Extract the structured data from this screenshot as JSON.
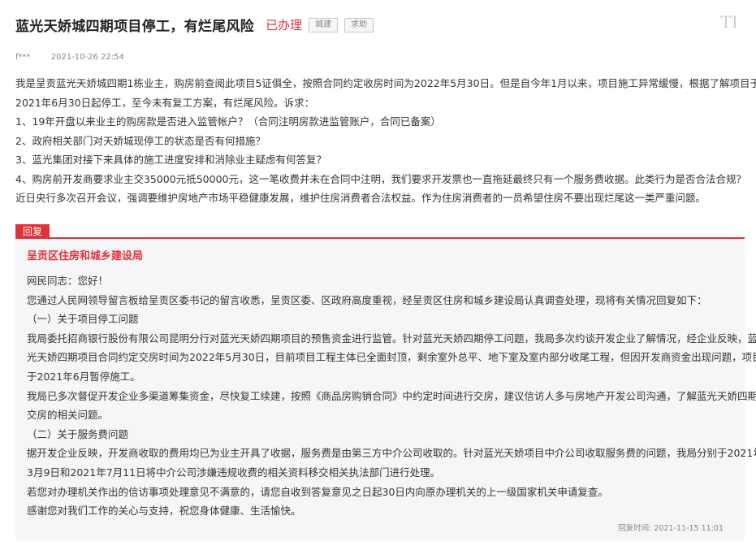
{
  "header": {
    "title": "蓝光天娇城四期项目停工，有烂尾风险",
    "status": "已办理",
    "tags": [
      "城建",
      "求助"
    ],
    "watermark": "Tl"
  },
  "meta": {
    "author": "f***",
    "datetime": "2021-10-26 22:54"
  },
  "question": {
    "lines": [
      "我是呈贡蓝光天娇城四期1栋业主，购房前查阅此项目5证俱全，按照合同约定收房时间为2022年5月30日。但是自今年1月以来，项目施工异常缓慢，根据了解项目于",
      "2021年6月30日起停工，至今未有复工方案，有烂尾风险。诉求：",
      "1、19年开盘以来业主的购房款是否进入监管帐户？（合同注明房款进监管账户，合同已备案）",
      "2、政府相关部门对天娇城现停工的状态是否有何措施？",
      "3、蓝光集团对接下来具体的施工进度安排和消除业主疑虑有何答复？",
      "4、购房前开发商要求业主交35000元抵50000元，这一笔收费并未在合同中注明，我们要求开发票也一直拖延最终只有一个服务费收据。此类行为是否合法合规？",
      "近日央行多次召开会议，强调要维护房地产市场平稳健康发展，维护住房消费者合法权益。作为住房消费者的一员希望住房不要出现烂尾这一类严重问题。"
    ]
  },
  "reply": {
    "badge": "回复",
    "org": "呈贡区住房和城乡建设局",
    "lines": [
      "网民同志：您好！",
      "您通过人民网领导留言板给呈贡区委书记的留言收悉，呈贡区委、区政府高度重视，经呈贡区住房和城乡建设局认真调查处理，现将有关情况回复如下：",
      "（一）关于项目停工问题",
      "我局委托招商银行股份有限公司昆明分行对蓝光天娇四期项目的预售资金进行监管。针对蓝光天娇四期停工问题，我局多次约谈开发企业了解情况，经企业反映，蓝",
      "光天娇四期项目合同约定交房时间为2022年5月30日，目前项目工程主体已全面封顶，剩余室外总平、地下室及室内部分收尾工程，但因开发商资金出现问题，项目",
      "于2021年6月暂停施工。",
      "我局已多次督促开发企业多渠道筹集资金，尽快复工续建，按照《商品房购销合同》中约定时间进行交房，建议信访人多与房地产开发公司沟通，了解蓝光天娇四期",
      "交房的相关问题。",
      "（二）关于服务费问题",
      "据开发企业反映，开发商收取的费用均已为业主开具了收据，服务费是由第三方中介公司收取的。针对蓝光天娇项目中介公司收取服务费的问题，我局分别于2021年",
      "3月9日和2021年7月11日将中介公司涉嫌违规收费的相关资料移交相关执法部门进行处理。",
      "若您对办理机关作出的信访事项处理意见不满意的，请您自收到答复意见之日起30日内向原办理机关的上一级国家机关申请复查。",
      "感谢您对我们工作的关心与支持，祝您身体健康、生活愉快。"
    ],
    "time_label": "回复时间:",
    "time": "2021-11-15 11:01"
  }
}
